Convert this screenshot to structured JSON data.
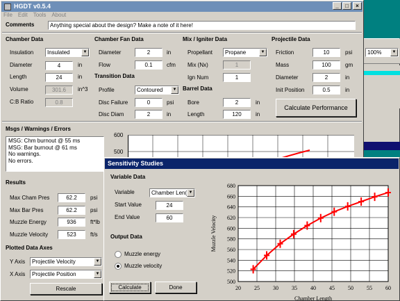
{
  "main": {
    "title": "HGDT v0.5.4",
    "menu": [
      "File",
      "Edit",
      "Tools",
      "About"
    ],
    "comments_label": "Comments",
    "comments_value": "Anything special about the design?  Make a note of it here!",
    "chamber": {
      "header": "Chamber Data",
      "insulation_label": "Insulation",
      "insulation_value": "Insulated",
      "diameter_label": "Diameter",
      "diameter_value": "4",
      "diameter_unit": "in",
      "length_label": "Length",
      "length_value": "24",
      "length_unit": "in",
      "volume_label": "Volume",
      "volume_value": "301.6",
      "volume_unit": "in^3",
      "cb_label": "C:B Ratio",
      "cb_value": "0.8"
    },
    "fan": {
      "header": "Chamber Fan Data",
      "diameter_label": "Diameter",
      "diameter_value": "2",
      "diameter_unit": "in",
      "flow_label": "Flow",
      "flow_value": "0.1",
      "flow_unit": "cfm"
    },
    "transition": {
      "header": "Transition Data",
      "profile_label": "Profile",
      "profile_value": "Contoured",
      "disc_failure_label": "Disc Failure",
      "disc_failure_value": "0",
      "disc_failure_unit": "psi",
      "disc_diam_label": "Disc Diam",
      "disc_diam_value": "2",
      "disc_diam_unit": "in"
    },
    "mix": {
      "header": "Mix / Igniter Data",
      "propellant_label": "Propellant",
      "propellant_value": "Propane",
      "mix_label": "Mix (Nx)",
      "mix_value": "1",
      "ign_label": "Ign Num",
      "ign_value": "1"
    },
    "barrel": {
      "header": "Barrel Data",
      "bore_label": "Bore",
      "bore_value": "2",
      "bore_unit": "in",
      "length_label": "Length",
      "length_value": "120",
      "length_unit": "in"
    },
    "projectile": {
      "header": "Projectile Data",
      "friction_label": "Friction",
      "friction_value": "10",
      "friction_unit": "psi",
      "mass_label": "Mass",
      "mass_value": "100",
      "mass_unit": "gm",
      "diameter_label": "Diameter",
      "diameter_value": "2",
      "diameter_unit": "in",
      "init_label": "Init Position",
      "init_value": "0.5",
      "init_unit": "in"
    },
    "calc_button": "Calculate Performance",
    "msgs_header": "Msgs / Warnings / Errors",
    "messages": [
      "MSG: Chm burnout @ 55 ms",
      "MSG: Bar burnout @ 61 ms",
      "No warnings.",
      "No errors."
    ],
    "results": {
      "header": "Results",
      "max_cham_label": "Max Cham Pres",
      "max_cham_value": "62.2",
      "max_cham_unit": "psi",
      "max_bar_label": "Max Bar Pres",
      "max_bar_value": "62.2",
      "max_bar_unit": "psi",
      "energy_label": "Muzzle Energy",
      "energy_value": "936",
      "energy_unit": "ft*lb",
      "velocity_label": "Muzzle Velocity",
      "velocity_value": "523",
      "velocity_unit": "ft/s"
    },
    "axes": {
      "header": "Plotted Data Axes",
      "y_label": "Y Axis",
      "y_value": "Projectile Velocity",
      "x_label": "X Axis",
      "x_value": "Projectile Position",
      "rescale": "Rescale"
    },
    "mini_plot_ticks": [
      "600",
      "500"
    ]
  },
  "background": {
    "zoom_value": "100%"
  },
  "sensitivity": {
    "title": "Sensitivity Studies",
    "variable_header": "Variable Data",
    "variable_label": "Variable",
    "variable_value": "Chamber Len(",
    "start_label": "Start Value",
    "start_value": "24",
    "end_label": "End Value",
    "end_value": "60",
    "output_header": "Output Data",
    "radio_energy": "Muzzle energy",
    "radio_velocity": "Muzzle velocity",
    "calculate": "Calculate",
    "done": "Done"
  },
  "chart_data": {
    "type": "line",
    "xlabel": "Chamber Length",
    "ylabel": "Muzzle Velocity",
    "xlim": [
      20,
      60
    ],
    "ylim": [
      500,
      680
    ],
    "xticks": [
      20,
      25,
      30,
      35,
      40,
      45,
      50,
      55,
      60
    ],
    "yticks": [
      500,
      520,
      540,
      560,
      580,
      600,
      620,
      640,
      660,
      680
    ],
    "x": [
      24,
      27.6,
      31.2,
      34.8,
      38.4,
      42,
      45.6,
      49.2,
      52.8,
      56.4,
      60
    ],
    "y": [
      523,
      549,
      571,
      589,
      605,
      619,
      631,
      641,
      650,
      659,
      667
    ],
    "color": "#ff0000"
  }
}
